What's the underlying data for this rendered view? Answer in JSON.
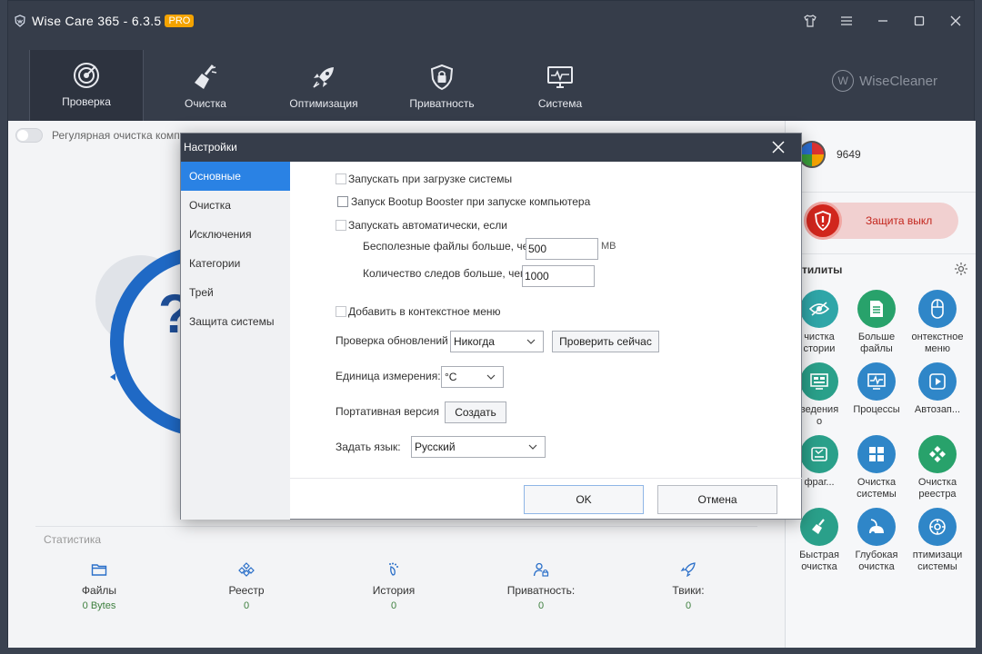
{
  "app": {
    "title": "Wise Care 365 - 6.3.5",
    "badge": "PRO",
    "brand": "WiseCleaner",
    "brand_mark": "W"
  },
  "nav": {
    "tabs": [
      {
        "label": "Проверка"
      },
      {
        "label": "Очистка"
      },
      {
        "label": "Оптимизация"
      },
      {
        "label": "Приватность"
      },
      {
        "label": "Система"
      }
    ]
  },
  "main": {
    "regular_clean_label": "Регулярная очистка компьютера",
    "question_mark": "?",
    "stats_title": "Статистика",
    "stats": [
      {
        "label": "Файлы",
        "value": "0 Bytes"
      },
      {
        "label": "Реестр",
        "value": "0"
      },
      {
        "label": "История",
        "value": "0"
      },
      {
        "label": "Приватность:",
        "value": "0"
      },
      {
        "label": "Твики:",
        "value": "0"
      }
    ]
  },
  "right_panel": {
    "score": "9649",
    "protection_label": "Защита выкл",
    "utilities_title": "тилиты",
    "utilities": [
      {
        "label": "чистка\nстории",
        "color": "#2fa6a8"
      },
      {
        "label": "Больше\nфайлы",
        "color": "#28a26b"
      },
      {
        "label": "онтекстное\nменю",
        "color": "#2f86c8"
      },
      {
        "label": "ведения\nо",
        "color": "#2aa08a"
      },
      {
        "label": "Процессы",
        "color": "#2f86c8"
      },
      {
        "label": "Автозап...",
        "color": "#2f86c8"
      },
      {
        "label": "фраг...",
        "color": "#2aa08a"
      },
      {
        "label": "Очистка\nсистемы",
        "color": "#2f86c8"
      },
      {
        "label": "Очистка\nреестра",
        "color": "#28a26b"
      },
      {
        "label": "Быстрая\nочистка",
        "color": "#2aa08a"
      },
      {
        "label": "Глубокая\nочистка",
        "color": "#2f86c8"
      },
      {
        "label": "птимизаци\nсистемы",
        "color": "#2f86c8"
      }
    ]
  },
  "dialog": {
    "title": "Настройки",
    "sidebar": [
      {
        "label": "Основные",
        "active": true
      },
      {
        "label": "Очистка"
      },
      {
        "label": "Исключения"
      },
      {
        "label": "Категории"
      },
      {
        "label": "Трей"
      },
      {
        "label": "Защита системы"
      }
    ],
    "general": {
      "start_on_boot": "Запускать при загрузке системы",
      "bootup_booster": "Запуск Bootup Booster при запуске компьютера",
      "auto_run_if": "Запускать автоматически, если",
      "junk_files_label": "Бесполезные файлы больше, чем",
      "junk_files_value": "500",
      "junk_files_unit": "MB",
      "traces_label": "Количество следов больше, чем",
      "traces_value": "1000",
      "context_menu": "Добавить в контекстное меню",
      "update_check_label": "Проверка обновлений",
      "update_check_value": "Никогда",
      "check_now": "Проверить сейчас",
      "unit_label": "Единица измерения:",
      "unit_value": "°C",
      "portable_label": "Портативная версия",
      "create_button": "Создать",
      "language_label": "Задать язык:",
      "language_value": "Русский"
    },
    "ok": "OK",
    "cancel": "Отмена"
  },
  "colors": {
    "accent": "#2a82e4",
    "titlebar": "#363d4a",
    "ring": "#1f69c5",
    "protect_red": "#d1261d"
  }
}
